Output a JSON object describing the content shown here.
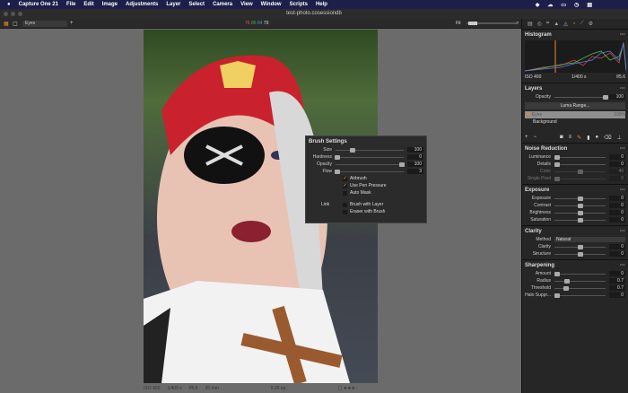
{
  "menubar": {
    "app": "Capture One 21",
    "items": [
      "File",
      "Edit",
      "Image",
      "Adjustments",
      "Layer",
      "Select",
      "Camera",
      "View",
      "Window",
      "Scripts",
      "Help"
    ]
  },
  "window": {
    "title": "test-photo.cosessiondb"
  },
  "toolbar": {
    "layer_select": "Eyes",
    "rgb": {
      "r": "76",
      "g": "85",
      "b": "64",
      "l": "79"
    },
    "zoom_label": "Fit"
  },
  "colors": {
    "accent": "#e88a2b",
    "menubar": "#1c1f4a",
    "panel": "#262626"
  },
  "histogram": {
    "title": "Histogram",
    "iso": "ISO 400",
    "shutter": "1/400 s",
    "aperture": "f/5.6"
  },
  "layers": {
    "title": "Layers",
    "opacity_label": "Opacity",
    "opacity": "100",
    "luma_button": "Luma Range...",
    "items": [
      {
        "name": "Eyes",
        "opacity": "100%",
        "checked": true
      },
      {
        "name": "Background"
      }
    ]
  },
  "noise": {
    "title": "Noise Reduction",
    "rows": [
      {
        "label": "Luminance",
        "value": "0",
        "pos": 0.05
      },
      {
        "label": "Details",
        "value": "0",
        "pos": 0.05
      },
      {
        "label": "Color",
        "value": "49",
        "pos": 0.5,
        "dim": true
      },
      {
        "label": "Single Pixel",
        "value": "0",
        "pos": 0.05,
        "dim": true
      }
    ]
  },
  "exposure": {
    "title": "Exposure",
    "rows": [
      {
        "label": "Exposure",
        "value": "0",
        "pos": 0.5
      },
      {
        "label": "Contrast",
        "value": "0",
        "pos": 0.5
      },
      {
        "label": "Brightness",
        "value": "0",
        "pos": 0.5
      },
      {
        "label": "Saturation",
        "value": "0",
        "pos": 0.5
      }
    ]
  },
  "clarity": {
    "title": "Clarity",
    "method_label": "Method",
    "method": "Natural",
    "rows": [
      {
        "label": "Clarity",
        "value": "0",
        "pos": 0.5
      },
      {
        "label": "Structure",
        "value": "0",
        "pos": 0.5
      }
    ]
  },
  "sharpening": {
    "title": "Sharpening",
    "rows": [
      {
        "label": "Amount",
        "value": "0",
        "pos": 0.05
      },
      {
        "label": "Radius",
        "value": "0.7",
        "pos": 0.25
      },
      {
        "label": "Threshold",
        "value": "0.7",
        "pos": 0.22
      },
      {
        "label": "Halo Suppr...",
        "value": "0",
        "pos": 0.05
      }
    ]
  },
  "brush": {
    "title": "Brush Settings",
    "rows": [
      {
        "label": "Size",
        "value": "100",
        "pos": 0.25
      },
      {
        "label": "Hardness",
        "value": "0",
        "pos": 0.02
      },
      {
        "label": "Opacity",
        "value": "100",
        "pos": 0.98
      },
      {
        "label": "Flow",
        "value": "3",
        "pos": 0.03
      }
    ],
    "checks": [
      {
        "label": "Airbrush",
        "checked": true
      },
      {
        "label": "Use Pen Pressure",
        "checked": true
      },
      {
        "label": "Auto Mask",
        "checked": false
      }
    ],
    "link_label": "Link",
    "link_checks": [
      {
        "label": "Brush with Layer",
        "checked": false
      },
      {
        "label": "Eraser with Brush",
        "checked": false
      }
    ]
  },
  "status": {
    "iso": "ISO 400",
    "shutter": "1/400 s",
    "aperture": "f/5.6",
    "focal": "35 mm",
    "ev": "0.26 ep",
    "rating": 3
  }
}
